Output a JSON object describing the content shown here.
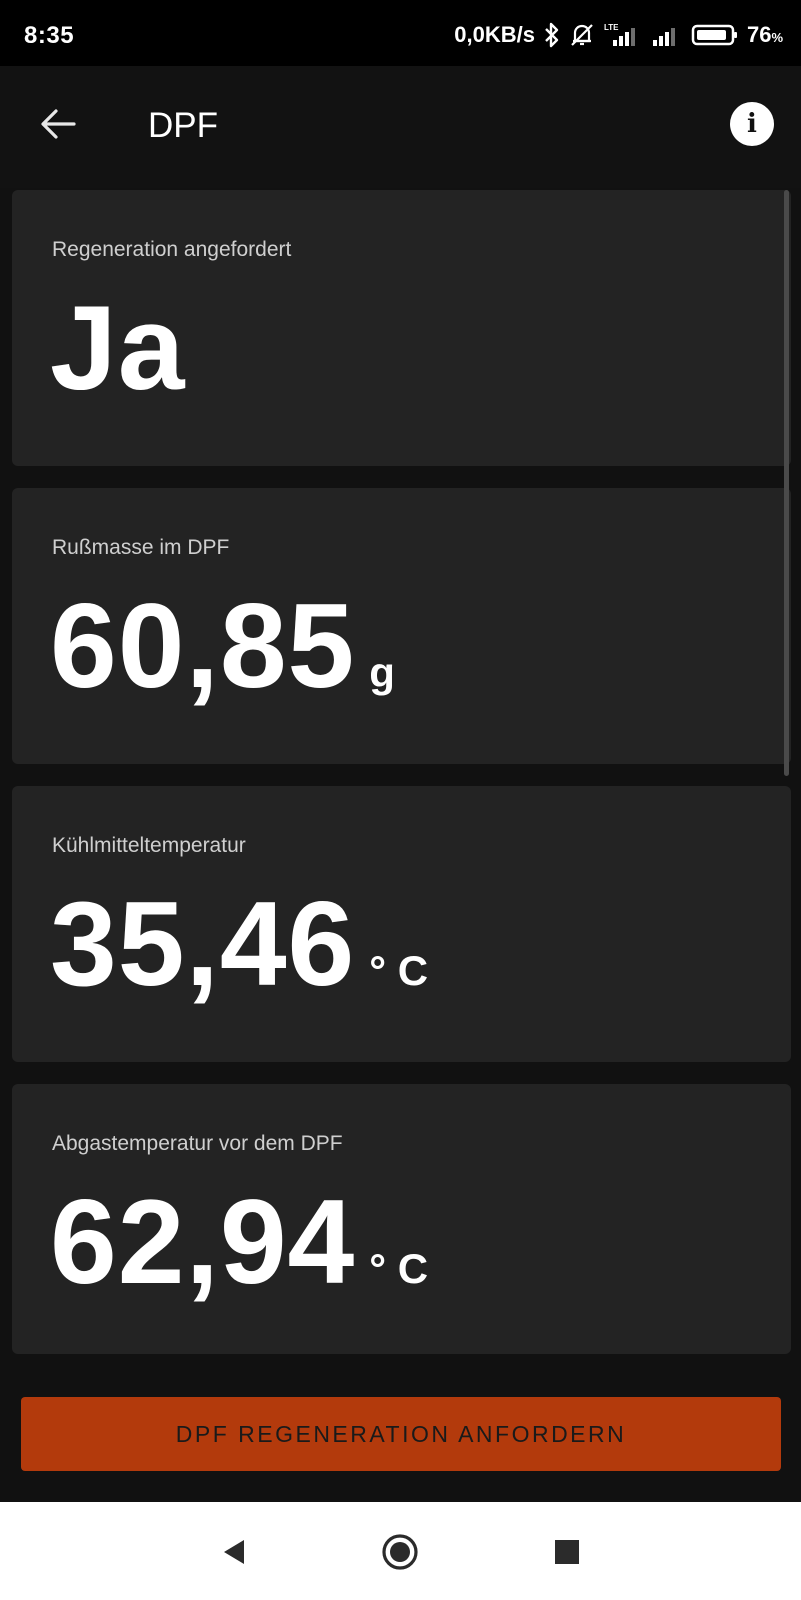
{
  "status_bar": {
    "time": "8:35",
    "network_speed": "0,0KB/s",
    "battery_level": "76",
    "battery_unit": "%"
  },
  "app_bar": {
    "title": "DPF"
  },
  "cards": [
    {
      "label": "Regeneration angefordert",
      "value": "Ja",
      "unit": ""
    },
    {
      "label": "Rußmasse im DPF",
      "value": "60,85",
      "unit": "g"
    },
    {
      "label": "Kühlmitteltemperatur",
      "value": "35,46",
      "unit": "° C"
    },
    {
      "label": "Abgastemperatur vor dem DPF",
      "value": "62,94",
      "unit": "° C"
    }
  ],
  "action_button": {
    "label": "DPF REGENERATION ANFORDERN",
    "color": "#b33a0c"
  },
  "icons": {
    "back": "arrow-left-icon",
    "info": "info-icon",
    "bluetooth": "bluetooth-icon",
    "mute": "bell-off-icon",
    "signal": "signal-icon",
    "battery": "battery-icon"
  }
}
